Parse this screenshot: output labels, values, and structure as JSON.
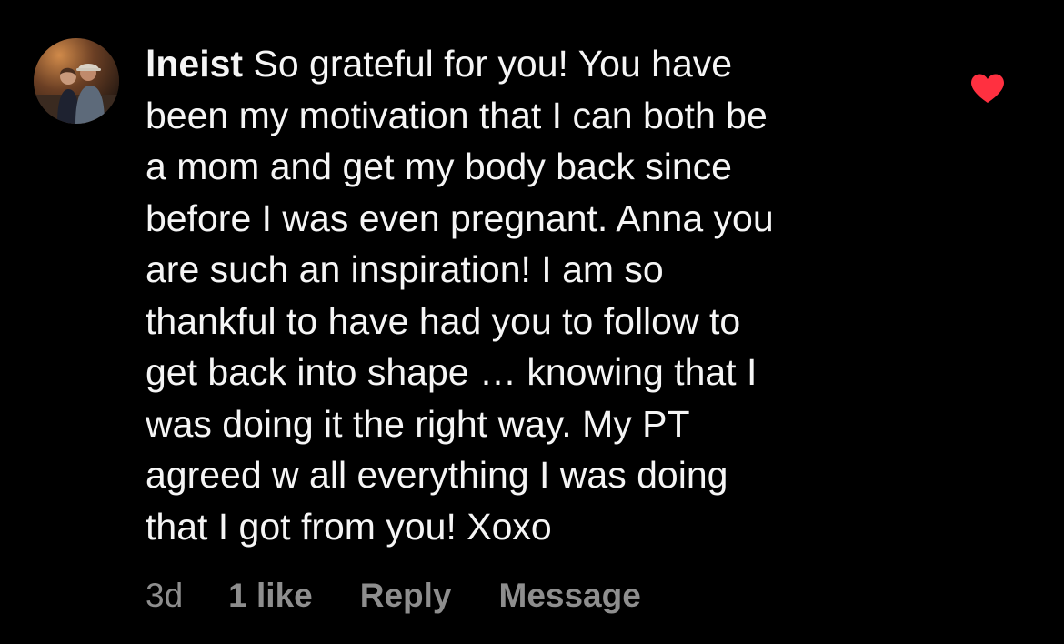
{
  "comment": {
    "username": "lneist",
    "text": "So grateful for you! You have\nbeen my motivation that I can both be\na mom and get my body back since\nbefore I was even pregnant. Anna you\nare such an inspiration! I am so\nthankful to have had you to follow to\nget back into shape … knowing that I\nwas doing it the right way. My PT\nagreed w all everything I was doing\nthat I got from you! Xoxo",
    "timestamp": "3d",
    "likes_label": "1 like",
    "reply_label": "Reply",
    "message_label": "Message",
    "liked": true
  },
  "icons": {
    "avatar": "avatar-photo",
    "like": "heart-icon"
  },
  "colors": {
    "background": "#000000",
    "text": "#f5f5f5",
    "meta": "#8e8e8e",
    "heart": "#ff3040"
  }
}
